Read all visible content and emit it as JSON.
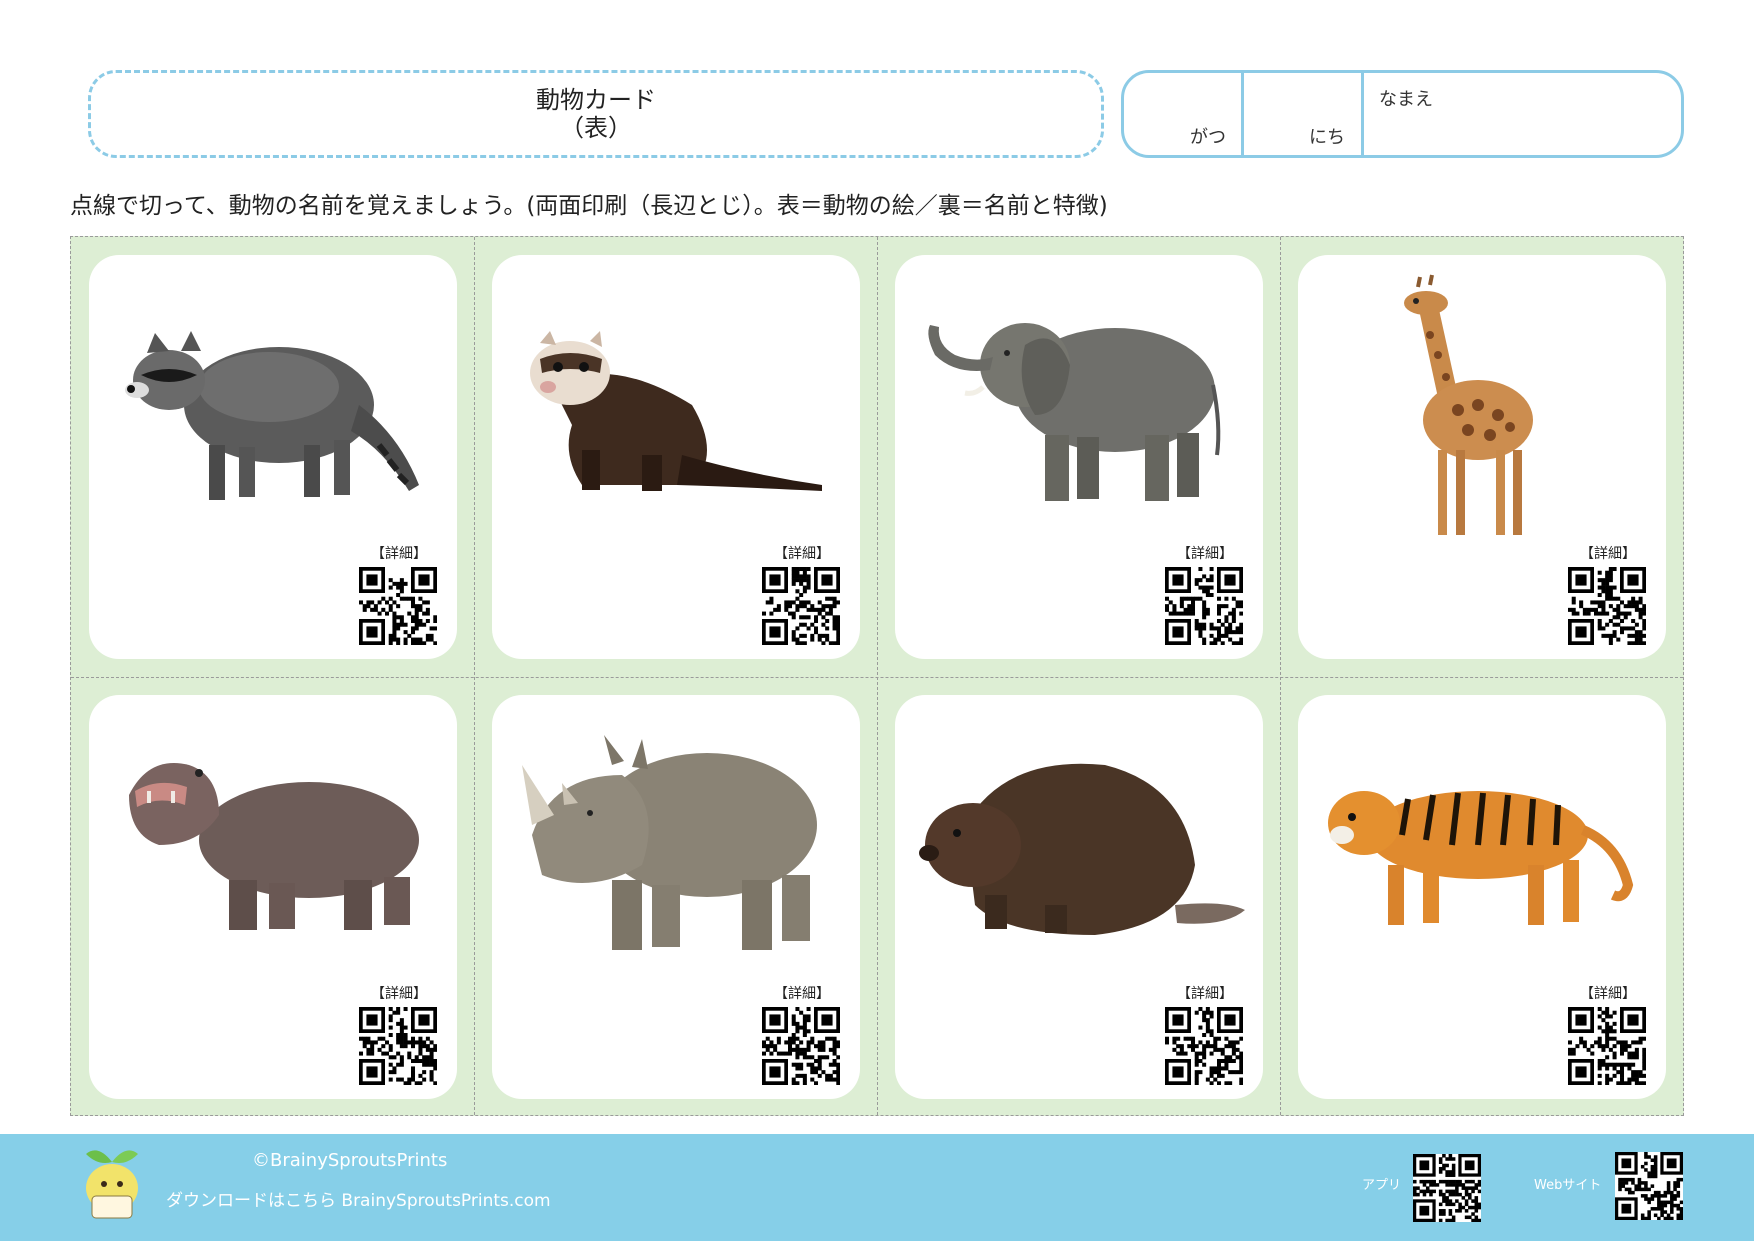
{
  "header": {
    "title": "動物カード",
    "subtitle": "（表）",
    "month_label": "がつ",
    "day_label": "にち",
    "name_label": "なまえ"
  },
  "instruction": "点線で切って、動物の名前を覚えましょう。(両面印刷（長辺とじ）。表＝動物の絵／裏＝名前と特徴)",
  "cards": [
    {
      "animal_icon": "raccoon-illustration",
      "detail_label": "【詳細】"
    },
    {
      "animal_icon": "ferret-illustration",
      "detail_label": "【詳細】"
    },
    {
      "animal_icon": "elephant-illustration",
      "detail_label": "【詳細】"
    },
    {
      "animal_icon": "giraffe-illustration",
      "detail_label": "【詳細】"
    },
    {
      "animal_icon": "hippopotamus-illustration",
      "detail_label": "【詳細】"
    },
    {
      "animal_icon": "rhinoceros-illustration",
      "detail_label": "【詳細】"
    },
    {
      "animal_icon": "beaver-illustration",
      "detail_label": "【詳細】"
    },
    {
      "animal_icon": "tiger-illustration",
      "detail_label": "【詳細】"
    }
  ],
  "footer": {
    "copyright": "©BrainySproutsPrints",
    "download_text": "ダウンロードはこちら BrainySproutsPrints.com",
    "app_label": "アプリ",
    "web_label": "Webサイト"
  },
  "colors": {
    "accent_blue": "#8ccbe6",
    "footer_blue": "#86cfe8",
    "grid_green": "#ddeed4"
  }
}
